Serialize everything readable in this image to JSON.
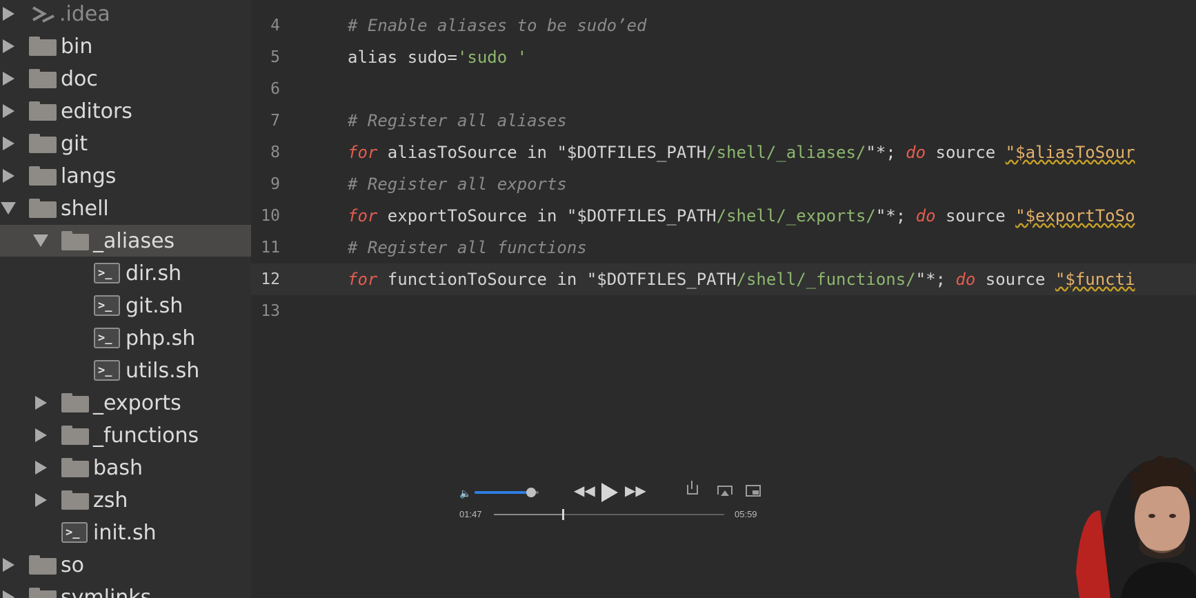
{
  "sidebar": {
    "items": [
      {
        "label": ".idea",
        "icon": "idea-icon",
        "indent": 0,
        "arrow": "right",
        "faded": true
      },
      {
        "label": "bin",
        "icon": "folder-icon",
        "indent": 0,
        "arrow": "right"
      },
      {
        "label": "doc",
        "icon": "folder-icon",
        "indent": 0,
        "arrow": "right"
      },
      {
        "label": "editors",
        "icon": "folder-icon",
        "indent": 0,
        "arrow": "right"
      },
      {
        "label": "git",
        "icon": "folder-icon",
        "indent": 0,
        "arrow": "right"
      },
      {
        "label": "langs",
        "icon": "folder-icon",
        "indent": 0,
        "arrow": "right"
      },
      {
        "label": "shell",
        "icon": "folder-icon",
        "indent": 0,
        "arrow": "down"
      },
      {
        "label": "_aliases",
        "icon": "folder-icon",
        "indent": 1,
        "arrow": "down",
        "selected": true
      },
      {
        "label": "dir.sh",
        "icon": "shell-file-icon",
        "indent": 2,
        "arrow": "none"
      },
      {
        "label": "git.sh",
        "icon": "shell-file-icon",
        "indent": 2,
        "arrow": "none"
      },
      {
        "label": "php.sh",
        "icon": "shell-file-icon",
        "indent": 2,
        "arrow": "none"
      },
      {
        "label": "utils.sh",
        "icon": "shell-file-icon",
        "indent": 2,
        "arrow": "none"
      },
      {
        "label": "_exports",
        "icon": "folder-icon",
        "indent": 1,
        "arrow": "right"
      },
      {
        "label": "_functions",
        "icon": "folder-icon",
        "indent": 1,
        "arrow": "right"
      },
      {
        "label": "bash",
        "icon": "folder-icon",
        "indent": 1,
        "arrow": "right"
      },
      {
        "label": "zsh",
        "icon": "folder-icon",
        "indent": 1,
        "arrow": "right"
      },
      {
        "label": "init.sh",
        "icon": "shell-file-icon",
        "indent": 1,
        "arrow": "none"
      },
      {
        "label": "so",
        "icon": "folder-icon",
        "indent": 0,
        "arrow": "right"
      },
      {
        "label": "symlinks",
        "icon": "folder-icon",
        "indent": 0,
        "arrow": "right"
      }
    ]
  },
  "editor": {
    "current_line": "12",
    "lines": [
      {
        "num": "4",
        "tokens": [
          {
            "t": "# Enable aliases to be sudo’ed",
            "c": "comment"
          }
        ]
      },
      {
        "num": "5",
        "tokens": [
          {
            "t": "alias sudo=",
            "c": "plain"
          },
          {
            "t": "'sudo '",
            "c": "str"
          }
        ]
      },
      {
        "num": "6",
        "tokens": []
      },
      {
        "num": "7",
        "tokens": [
          {
            "t": "# Register all aliases",
            "c": "comment"
          }
        ]
      },
      {
        "num": "8",
        "tokens": [
          {
            "t": "for",
            "c": "kw"
          },
          {
            "t": " aliasToSource in \"$DOTFILES_PATH",
            "c": "plain"
          },
          {
            "t": "/shell/_aliases/",
            "c": "str"
          },
          {
            "t": "\"*; ",
            "c": "plain"
          },
          {
            "t": "do",
            "c": "kw"
          },
          {
            "t": " source ",
            "c": "plain"
          },
          {
            "t": "\"$aliasToSour",
            "c": "var"
          }
        ]
      },
      {
        "num": "9",
        "tokens": [
          {
            "t": "# Register all exports",
            "c": "comment"
          }
        ]
      },
      {
        "num": "10",
        "tokens": [
          {
            "t": "for",
            "c": "kw"
          },
          {
            "t": " exportToSource in \"$DOTFILES_PATH",
            "c": "plain"
          },
          {
            "t": "/shell/_exports/",
            "c": "str"
          },
          {
            "t": "\"*; ",
            "c": "plain"
          },
          {
            "t": "do",
            "c": "kw"
          },
          {
            "t": " source ",
            "c": "plain"
          },
          {
            "t": "\"$exportToSo",
            "c": "var"
          }
        ]
      },
      {
        "num": "11",
        "tokens": [
          {
            "t": "# Register all functions",
            "c": "comment"
          }
        ]
      },
      {
        "num": "12",
        "tokens": [
          {
            "t": "for",
            "c": "kw"
          },
          {
            "t": " functionToSource in \"$DOTFILES_PATH",
            "c": "plain"
          },
          {
            "t": "/shell/_functions/",
            "c": "str"
          },
          {
            "t": "\"*; ",
            "c": "plain"
          },
          {
            "t": "do",
            "c": "kw"
          },
          {
            "t": " source ",
            "c": "plain"
          },
          {
            "t": "\"$functi",
            "c": "var"
          }
        ]
      },
      {
        "num": "13",
        "tokens": []
      }
    ]
  },
  "player": {
    "volume_icon": "speaker-icon",
    "volume_level": 0.88,
    "rewind_icon": "rewind-icon",
    "play_icon": "play-icon",
    "forward_icon": "fast-forward-icon",
    "share_icon": "share-icon",
    "airplay_icon": "airplay-icon",
    "pip_icon": "picture-in-picture-icon",
    "elapsed": "01:47",
    "total": "05:59",
    "progress": 0.298,
    "accent_color": "#2f7de1"
  },
  "colors": {
    "editor_bg": "#2b2b2b",
    "sidebar_bg": "#2f2f2f",
    "selected_row": "#4a4846",
    "keyword": "#e45c4f",
    "string": "#8db76f",
    "comment": "#8a8a8a"
  }
}
